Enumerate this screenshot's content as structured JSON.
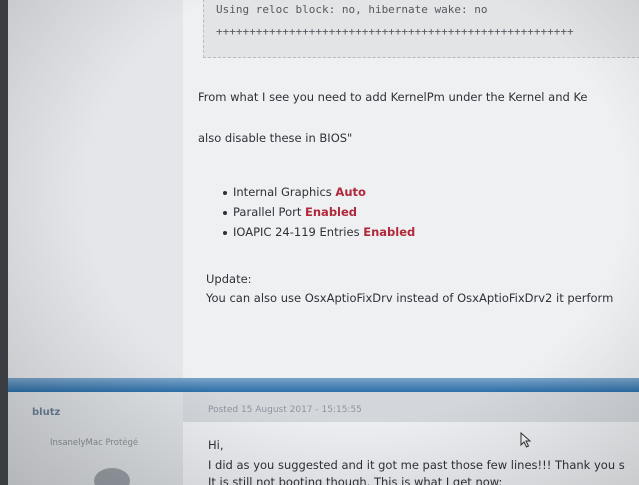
{
  "top_post": {
    "code_lines": [
      "Using reloc block: no, hibernate wake: no",
      "++++++++++++++++++++++++++++++++++++++++++++++++++++++"
    ],
    "line1": "From what I see you need to add KernelPm under the Kernel and Ke",
    "line2": "also disable these in BIOS\"",
    "bios_items": [
      {
        "label": "Internal Graphics",
        "value": "Auto"
      },
      {
        "label": "Parallel Port",
        "value": "Enabled"
      },
      {
        "label": "IOAPIC 24-119 Entries",
        "value": "Enabled"
      }
    ],
    "update_label": "Update:",
    "update_text": "You can also use OsxAptioFixDrv instead of OsxAptioFixDrv2 it perform"
  },
  "reply_post": {
    "username": "blutz",
    "user_title": "InsanelyMac Protégé",
    "date": "Posted 15 August 2017 - 15:15:55",
    "greeting": "Hi,",
    "line1": "I did as you suggested and it got me past those few lines!!! Thank you s",
    "line2": "It is still not booting though. This is what I get now:"
  },
  "colors": {
    "highlight": "#b0283a",
    "divider": "#2d6fa8"
  },
  "icons": [
    "mouse-cursor-icon"
  ]
}
